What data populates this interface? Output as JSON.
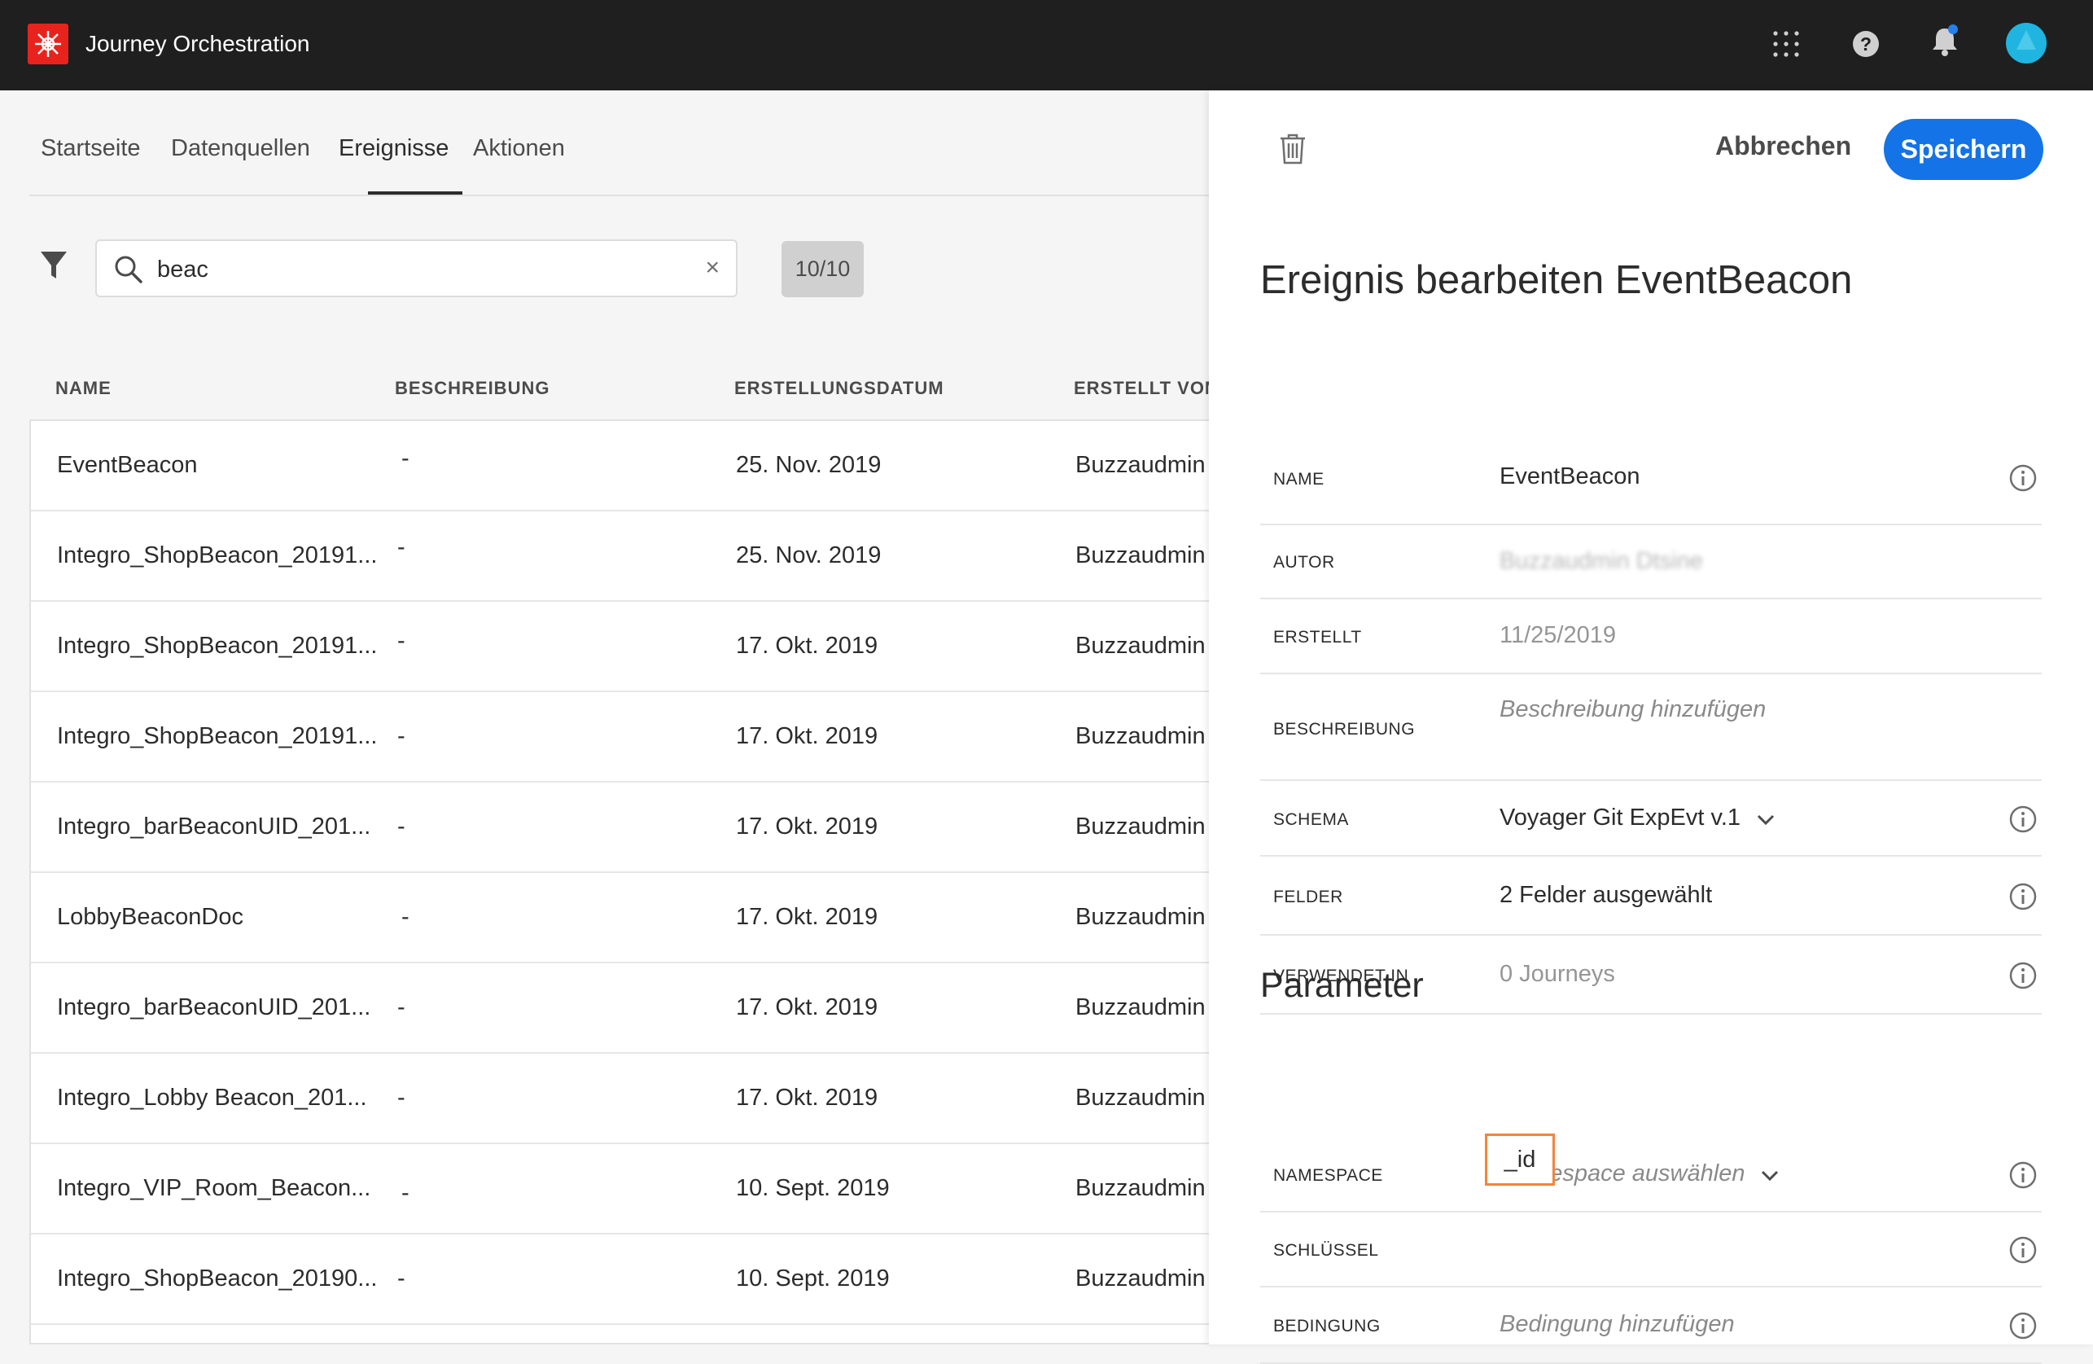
{
  "app": {
    "title": "Journey Orchestration"
  },
  "tabs": [
    {
      "label": "Startseite"
    },
    {
      "label": "Datenquellen"
    },
    {
      "label": "Ereignisse",
      "active": true
    },
    {
      "label": "Aktionen"
    }
  ],
  "search": {
    "value": "beac",
    "counter": "10/10"
  },
  "table": {
    "columns": [
      "NAME",
      "BESCHREIBUNG",
      "ERSTELLUNGSDATUM",
      "ERSTELLT VON"
    ],
    "rows": [
      {
        "name": "EventBeacon",
        "description": "-",
        "created": "25. Nov. 2019",
        "created_by": "Buzzaudmin D"
      },
      {
        "name": "Integro_ShopBeacon_20191...",
        "description": "-",
        "created": "25. Nov. 2019",
        "created_by": "Buzzaudmin D"
      },
      {
        "name": "Integro_ShopBeacon_20191...",
        "description": "-",
        "created": "17. Okt. 2019",
        "created_by": "Buzzaudmin D"
      },
      {
        "name": "Integro_ShopBeacon_20191...",
        "description": "-",
        "created": "17. Okt. 2019",
        "created_by": "Buzzaudmin D"
      },
      {
        "name": "Integro_barBeaconUID_201...",
        "description": "-",
        "created": "17. Okt. 2019",
        "created_by": "Buzzaudmin D"
      },
      {
        "name": "LobbyBeaconDoc",
        "description": "-",
        "created": "17. Okt. 2019",
        "created_by": "Buzzaudmin D"
      },
      {
        "name": "Integro_barBeaconUID_201...",
        "description": "-",
        "created": "17. Okt. 2019",
        "created_by": "Buzzaudmin D"
      },
      {
        "name": "Integro_Lobby Beacon_201...",
        "description": "-",
        "created": "17. Okt. 2019",
        "created_by": "Buzzaudmin D"
      },
      {
        "name": "Integro_VIP_Room_Beacon...",
        "description": "-",
        "created": "10. Sept. 2019",
        "created_by": "Buzzaudmin D"
      },
      {
        "name": "Integro_ShopBeacon_20190...",
        "description": "-",
        "created": "10. Sept. 2019",
        "created_by": "Buzzaudmin D"
      }
    ]
  },
  "panel": {
    "cancel_label": "Abbrechen",
    "save_label": "Speichern",
    "title": "Ereignis bearbeiten EventBeacon",
    "fields": {
      "name": {
        "label": "NAME",
        "value": "EventBeacon"
      },
      "author": {
        "label": "AUTOR",
        "value": "Buzzaudmin Dtsine"
      },
      "created": {
        "label": "ERSTELLT",
        "value": "11/25/2019"
      },
      "description": {
        "label": "BESCHREIBUNG",
        "placeholder": "Beschreibung hinzufügen"
      },
      "schema": {
        "label": "SCHEMA",
        "value": "Voyager Git ExpEvt v.1"
      },
      "fields": {
        "label": "FELDER",
        "value": "2 Felder ausgewählt"
      },
      "used_in": {
        "label": "VERWENDET IN",
        "value": "0 Journeys"
      }
    },
    "parameters": {
      "title": "Parameter",
      "namespace": {
        "label": "NAMESPACE",
        "placeholder": "Namespace auswählen"
      },
      "key": {
        "label": "SCHLÜSSEL",
        "value": "_id"
      },
      "condition": {
        "label": "BEDINGUNG",
        "placeholder": "Bedingung hinzufügen"
      }
    }
  },
  "colors": {
    "accent": "#1473e6",
    "brand": "#e8231d",
    "topbar": "#1f1f1f",
    "highlight": "#f5833b",
    "avatar": "#1fb5e0"
  },
  "icons": [
    "adobe-logo-icon",
    "apps-grid-icon",
    "help-icon",
    "bell-icon",
    "avatar-icon",
    "filter-icon",
    "search-icon",
    "clear-icon",
    "trash-icon",
    "info-icon",
    "chevron-down-icon"
  ]
}
